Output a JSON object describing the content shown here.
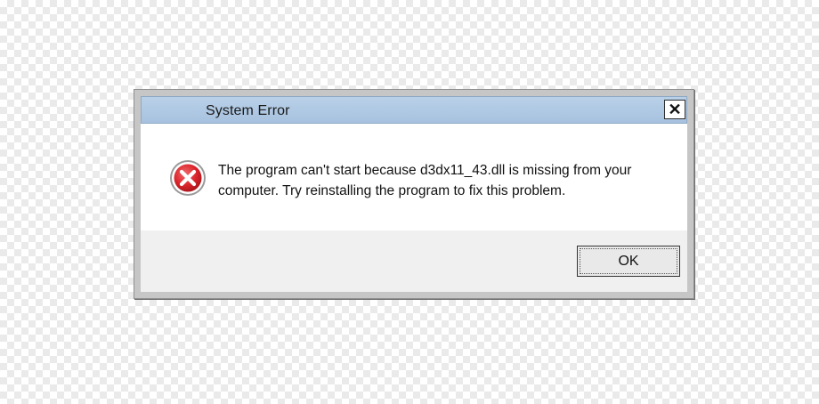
{
  "dialog": {
    "title": "System Error",
    "close_label": "✕",
    "message_line1": "The program can't start because d3dx11_43.dll  is missing from your",
    "message_line2": "computer. Try reinstalling the program to fix this problem.",
    "ok_label": "OK",
    "icon": "error-icon"
  },
  "colors": {
    "titlebar": "#b3cbe5",
    "error_red": "#d9232a",
    "frame": "#c6c6c6"
  }
}
